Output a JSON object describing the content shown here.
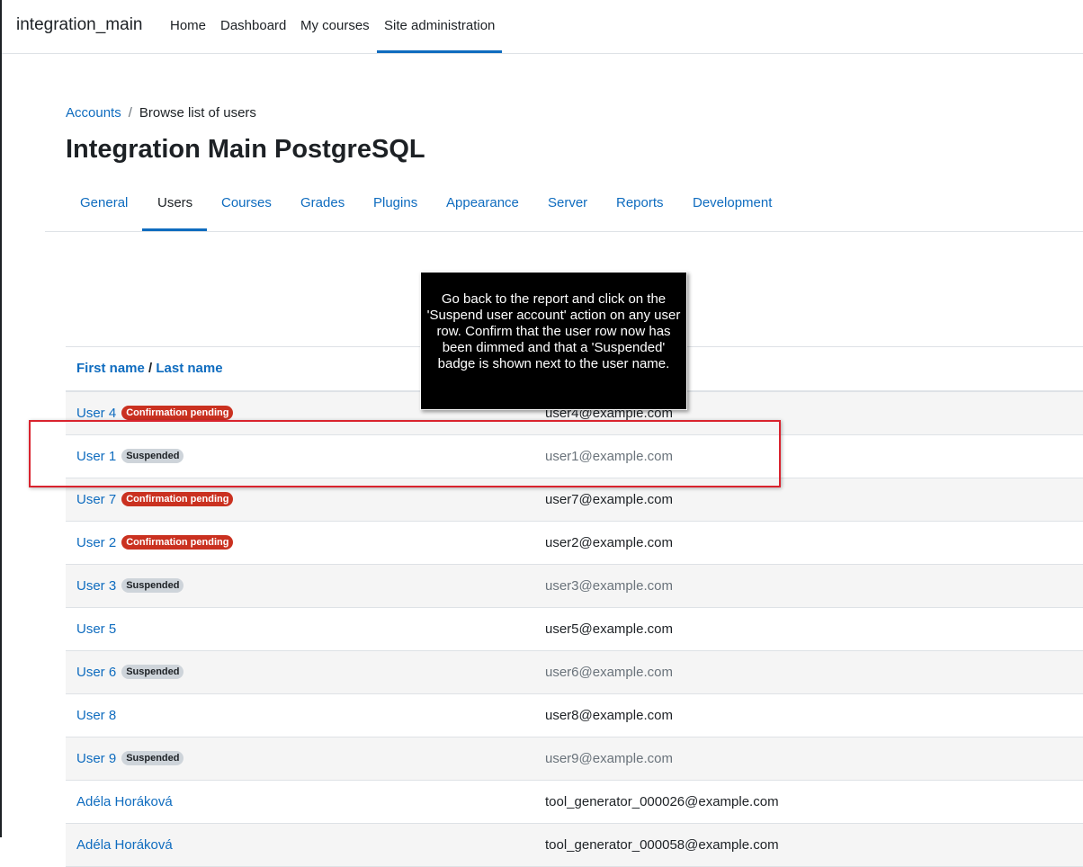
{
  "navbar": {
    "brand": "integration_main",
    "items": [
      "Home",
      "Dashboard",
      "My courses",
      "Site administration"
    ],
    "active": "Site administration"
  },
  "breadcrumb": {
    "link": "Accounts",
    "separator": "/",
    "current": "Browse list of users"
  },
  "page_title": "Integration Main PostgreSQL",
  "tabs": [
    "General",
    "Users",
    "Courses",
    "Grades",
    "Plugins",
    "Appearance",
    "Server",
    "Reports",
    "Development"
  ],
  "active_tab": "Users",
  "table": {
    "header": {
      "first_name": "First name",
      "slash": " / ",
      "last_name": "Last name"
    },
    "rows": [
      {
        "name": "User 4",
        "badge": "Confirmation pending",
        "email": "user4@example.com"
      },
      {
        "name": "User 1",
        "badge": "Suspended",
        "email": "user1@example.com"
      },
      {
        "name": "User 7",
        "badge": "Confirmation pending",
        "email": "user7@example.com"
      },
      {
        "name": "User 2",
        "badge": "Confirmation pending",
        "email": "user2@example.com"
      },
      {
        "name": "User 3",
        "badge": "Suspended",
        "email": "user3@example.com"
      },
      {
        "name": "User 5",
        "badge": "",
        "email": "user5@example.com"
      },
      {
        "name": "User 6",
        "badge": "Suspended",
        "email": "user6@example.com"
      },
      {
        "name": "User 8",
        "badge": "",
        "email": "user8@example.com"
      },
      {
        "name": "User 9",
        "badge": "Suspended",
        "email": "user9@example.com"
      },
      {
        "name": "Adéla Horáková",
        "badge": "",
        "email": "tool_generator_000026@example.com"
      },
      {
        "name": "Adéla Horáková",
        "badge": "",
        "email": "tool_generator_000058@example.com"
      }
    ]
  },
  "tooltip": {
    "text": "Go back to the report and click on the 'Suspend user account' action on any user row. Confirm that the user row now has been dimmed and that a 'Suspended' badge is shown next to the user name."
  },
  "colors": {
    "link": "#0f6cbf",
    "danger_badge": "#ca3120",
    "secondary_badge": "#ced4da",
    "highlight": "#d9232e"
  }
}
